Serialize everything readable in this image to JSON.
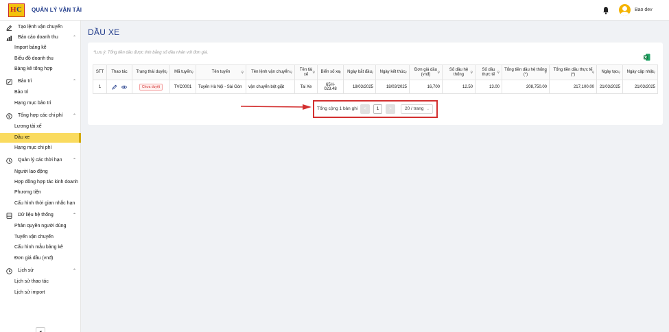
{
  "header": {
    "logo_h": "H",
    "logo_c": "C",
    "app_title": "QUẢN LÝ VẬN TẢI",
    "user_name": "Bao dev"
  },
  "sidebar": {
    "items": [
      {
        "kind": "parent",
        "label": "Tạo lệnh vận chuyển",
        "icon": "edit-icon",
        "chevron": ""
      },
      {
        "kind": "parent",
        "label": "Báo cáo doanh thu",
        "icon": "chart-icon",
        "chevron": "^"
      },
      {
        "kind": "child",
        "label": "Import bảng kê"
      },
      {
        "kind": "child",
        "label": "Biểu đồ doanh thu"
      },
      {
        "kind": "child",
        "label": "Bảng kê tổng hợp"
      },
      {
        "kind": "parent",
        "label": "Bảo trì",
        "icon": "wrench-icon",
        "chevron": "^"
      },
      {
        "kind": "child",
        "label": "Bảo trì"
      },
      {
        "kind": "child",
        "label": "Hạng mục bảo trì"
      },
      {
        "kind": "parent",
        "label": "Tổng hợp các chi phí",
        "icon": "money-icon",
        "chevron": "^"
      },
      {
        "kind": "child",
        "label": "Lương tài xế"
      },
      {
        "kind": "child",
        "label": "Dầu xe",
        "active": true
      },
      {
        "kind": "child",
        "label": "Hạng mục chi phí"
      },
      {
        "kind": "parent",
        "label": "Quản lý các thời hạn",
        "icon": "clock-icon",
        "chevron": "^"
      },
      {
        "kind": "child",
        "label": "Người lao động"
      },
      {
        "kind": "child",
        "label": "Hợp đồng hợp tác kinh doanh"
      },
      {
        "kind": "child",
        "label": "Phương tiện"
      },
      {
        "kind": "child",
        "label": "Cấu hình thời gian nhắc hạn"
      },
      {
        "kind": "parent",
        "label": "Dữ liệu hệ thống",
        "icon": "database-icon",
        "chevron": "^"
      },
      {
        "kind": "child",
        "label": "Phân quyền người dùng"
      },
      {
        "kind": "child",
        "label": "Tuyến vận chuyển"
      },
      {
        "kind": "child",
        "label": "Cấu hình mẫu bảng kê"
      },
      {
        "kind": "child",
        "label": "Đơn giá dầu (vnđ)"
      },
      {
        "kind": "parent",
        "label": "Lịch sử",
        "icon": "history-icon",
        "chevron": "^"
      },
      {
        "kind": "child",
        "label": "Lịch sử thao tác"
      },
      {
        "kind": "child",
        "label": "Lịch sử import"
      }
    ],
    "collapse_label": "◂"
  },
  "main": {
    "page_title": "DẦU XE",
    "note": "*Lưu ý: Tổng tiền dầu được tính bằng số dầu nhân với đơn giá.",
    "table": {
      "headers": [
        "STT",
        "Thao tác",
        "Trạng thái duyệt",
        "Mã tuyến",
        "Tên tuyến",
        "Tên lệnh vận chuyển",
        "Tên tài xế",
        "Biển số xe",
        "Ngày bắt đầu",
        "Ngày kết thúc",
        "Đơn giá dầu (vnđ)",
        "Số dầu hệ thống",
        "Số dầu thực tế",
        "Tổng tiền dầu hệ thống (*)",
        "Tổng tiền dầu thực tế (*)",
        "Ngày tạo",
        "Ngày cập nhật"
      ],
      "rows": [
        {
          "stt": "1",
          "status": "Chưa duyệt",
          "ma_tuyen": "TVC0001",
          "ten_tuyen": "Tuyến Hà Nội - Sài Gòn",
          "ten_lenh": "vận chuyển bột giặt",
          "tai_xe": "Tai Xe",
          "bien_so": "65H-023.48",
          "ngay_bat_dau": "18/03/2025",
          "ngay_ket_thuc": "18/03/2025",
          "don_gia": "16,700",
          "so_dau_ht": "12.50",
          "so_dau_tt": "13.00",
          "tong_ht": "208,750.00",
          "tong_tt": "217,100.00",
          "ngay_tao": "21/03/2025",
          "ngay_cap_nhat": "21/03/2025"
        }
      ]
    },
    "pagination": {
      "total_text": "Tổng cộng 1 bản ghi",
      "current_page": "1",
      "page_size": "20 / trang",
      "prev": "<",
      "next": ">"
    }
  },
  "colors": {
    "accent": "#1f3a8a",
    "active_bg": "#fadb5f",
    "highlight": "#d32f2f"
  }
}
